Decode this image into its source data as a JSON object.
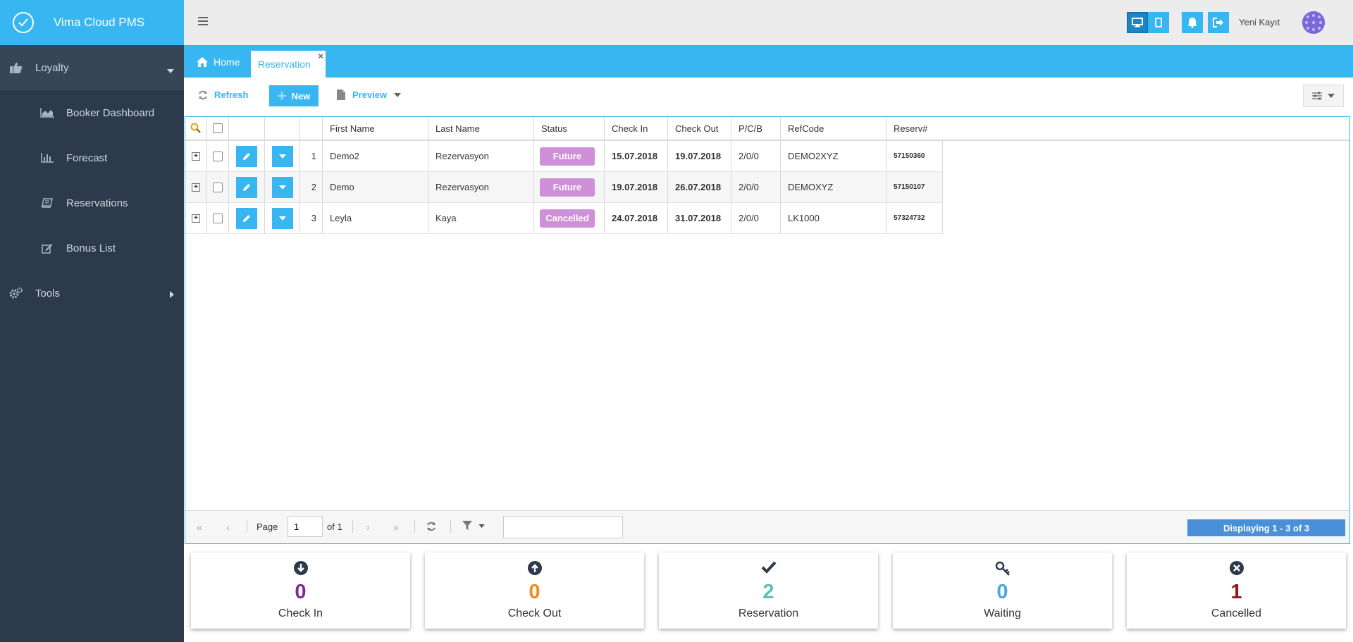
{
  "app": {
    "title": "Vima Cloud PMS"
  },
  "sidebar": {
    "groups": [
      {
        "label": "Loyalty",
        "items": [
          {
            "label": "Booker Dashboard"
          },
          {
            "label": "Forecast"
          },
          {
            "label": "Reservations"
          },
          {
            "label": "Bonus List"
          }
        ]
      },
      {
        "label": "Tools"
      }
    ]
  },
  "header": {
    "user_name": "Yeni Kayıt"
  },
  "tabs": {
    "home": "Home",
    "active": "Reservation",
    "close": "×"
  },
  "toolbar": {
    "refresh": "Refresh",
    "new": "New",
    "preview": "Preview"
  },
  "grid": {
    "columns": [
      "First Name",
      "Last Name",
      "Status",
      "Check In",
      "Check Out",
      "P/C/B",
      "RefCode",
      "Reserv#"
    ],
    "rows": [
      {
        "index": "1",
        "first_name": "Demo2",
        "last_name": "Rezervasyon",
        "status": "Future",
        "check_in": "15.07.2018",
        "check_out": "19.07.2018",
        "pcb": "2/0/0",
        "refcode": "DEMO2XYZ",
        "reserv": "57150360"
      },
      {
        "index": "2",
        "first_name": "Demo",
        "last_name": "Rezervasyon",
        "status": "Future",
        "check_in": "19.07.2018",
        "check_out": "26.07.2018",
        "pcb": "2/0/0",
        "refcode": "DEMOXYZ",
        "reserv": "57150107"
      },
      {
        "index": "3",
        "first_name": "Leyla",
        "last_name": "Kaya",
        "status": "Cancelled",
        "check_in": "24.07.2018",
        "check_out": "31.07.2018",
        "pcb": "2/0/0",
        "refcode": "LK1000",
        "reserv": "57324732"
      }
    ]
  },
  "pager": {
    "page_label": "Page",
    "page_value": "1",
    "of_label": "of 1",
    "displaying": "Displaying 1 - 3 of 3"
  },
  "stats": [
    {
      "label": "Check In",
      "value": "0",
      "color": "#7b2d8e",
      "icon": "arrow-down-circle-icon"
    },
    {
      "label": "Check Out",
      "value": "0",
      "color": "#f08a24",
      "icon": "arrow-up-circle-icon"
    },
    {
      "label": "Reservation",
      "value": "2",
      "color": "#5bc0b5",
      "icon": "check-icon"
    },
    {
      "label": "Waiting",
      "value": "0",
      "color": "#4aa8e0",
      "icon": "key-icon"
    },
    {
      "label": "Cancelled",
      "value": "1",
      "color": "#8b1a1a",
      "icon": "times-circle-icon"
    }
  ],
  "colors": {
    "accent": "#38b6f1",
    "sidebar": "#2c3a4b",
    "status_badge": "#ce90d8"
  }
}
